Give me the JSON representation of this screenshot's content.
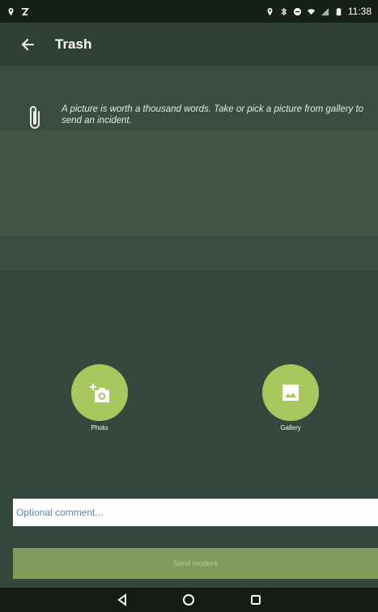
{
  "status_bar": {
    "time": "11:38",
    "left_icons": [
      "location-icon",
      "notification-icon"
    ],
    "right_icons": [
      "location-icon",
      "bluetooth-icon",
      "do-not-disturb-icon",
      "wifi-icon",
      "signal-icon",
      "battery-icon"
    ]
  },
  "app_bar": {
    "title": "Trash",
    "back_icon": "back-arrow-icon"
  },
  "hint": {
    "icon": "paperclip-icon",
    "text": "A picture is worth a thousand words. Take or pick a picture from gallery to send an incident."
  },
  "actions": {
    "photo": {
      "label": "Photo",
      "icon": "add-photo-icon"
    },
    "gallery": {
      "label": "Gallery",
      "icon": "gallery-icon"
    }
  },
  "comment": {
    "placeholder": "Optional comment...",
    "value": ""
  },
  "send": {
    "label": "Send incident"
  },
  "nav": {
    "back": "triangle-back-icon",
    "home": "circle-home-icon",
    "recent": "square-recent-icon"
  },
  "colors": {
    "background": "#35483d",
    "accent": "#a8c85d",
    "send_button": "#829b5d",
    "status_bar": "#172018"
  }
}
